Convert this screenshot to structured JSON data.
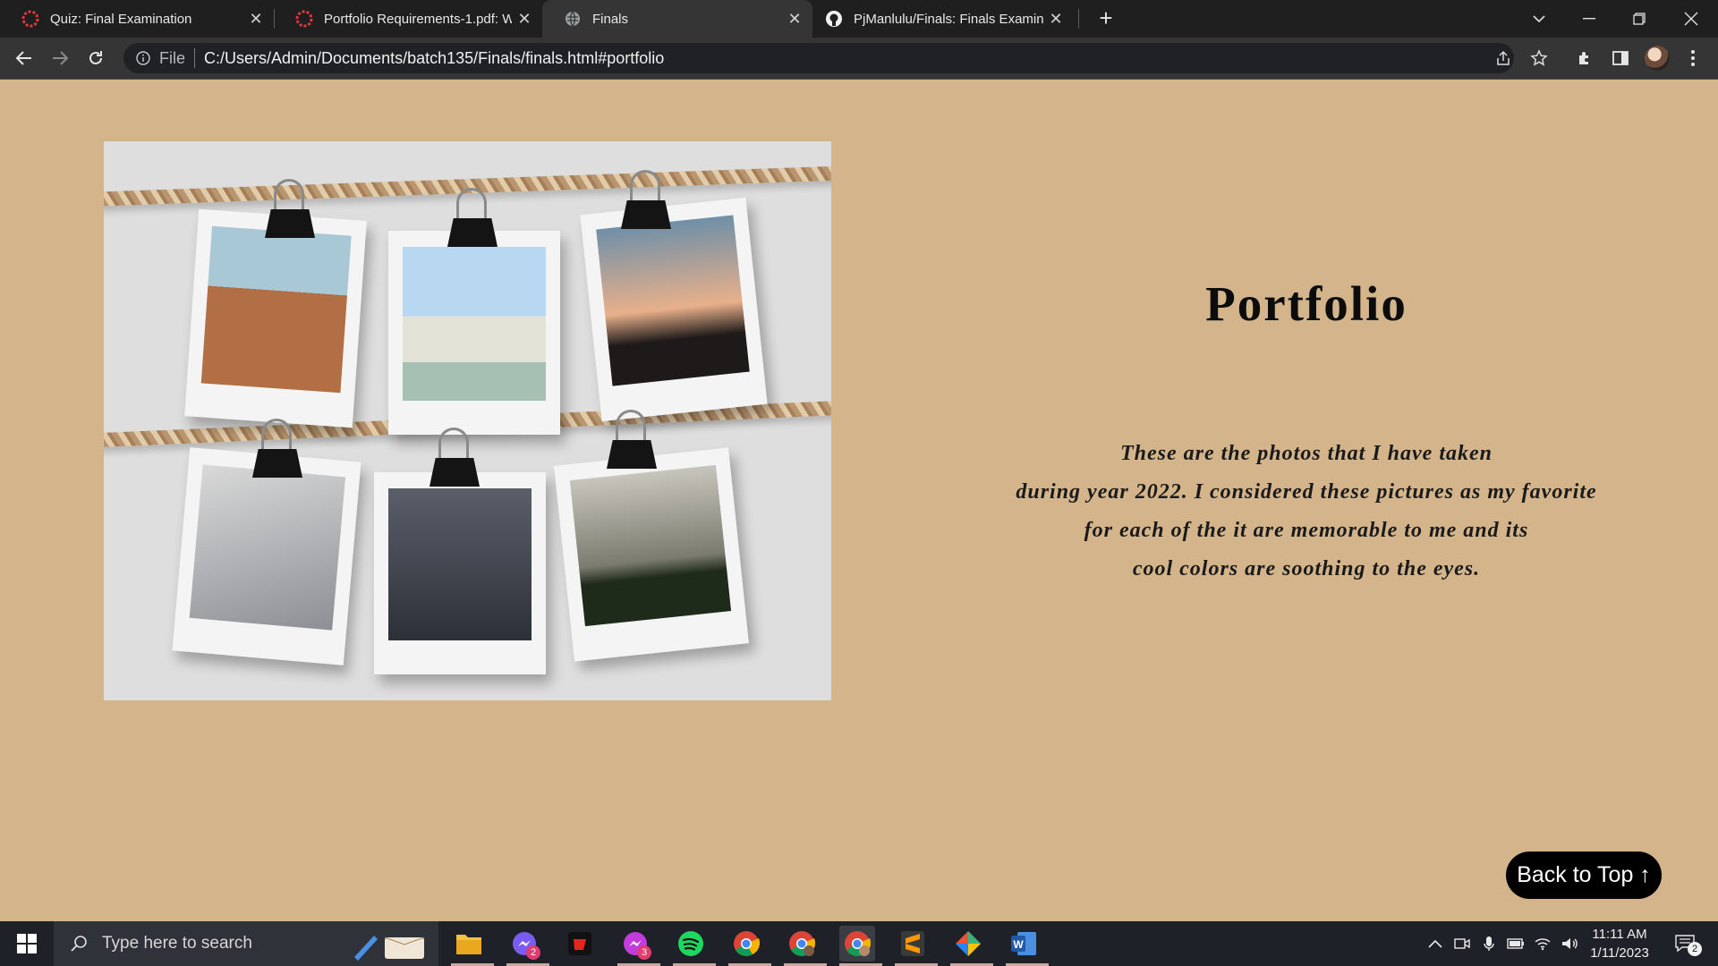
{
  "browser": {
    "tabs": [
      {
        "title": "Quiz: Final Examination",
        "icon": "canvas-icon"
      },
      {
        "title": "Portfolio Requirements-1.pdf: We",
        "icon": "canvas-icon"
      },
      {
        "title": "Finals",
        "icon": "globe-icon",
        "active": true
      },
      {
        "title": "PjManlulu/Finals: Finals Examinat",
        "icon": "github-icon"
      }
    ],
    "omnibox": {
      "scheme_label": "File",
      "url": "C:/Users/Admin/Documents/batch135/Finals/finals.html#portfolio"
    }
  },
  "page": {
    "title": "Portfolio",
    "description_lines": [
      "These are the photos that I have taken",
      "during year 2022. I considered these pictures as my favorite",
      "for each of the it are memorable to me and its",
      "cool colors are soothing to the eyes."
    ],
    "back_to_top_label": "Back to Top ↑",
    "background_color": "#d3b48b"
  },
  "taskbar": {
    "search_placeholder": "Type here to search",
    "time": "11:11 AM",
    "date": "1/11/2023",
    "notification_count": "2",
    "messenger_badge": "2",
    "app_badge": "3",
    "pinned_apps": [
      "file-explorer-icon",
      "messenger-icon",
      "garena-icon",
      "messenger-app-icon",
      "spotify-icon",
      "chrome-icon",
      "chrome-profile-icon",
      "chrome-active-icon",
      "sublime-text-icon",
      "git-icon",
      "word-icon"
    ]
  }
}
